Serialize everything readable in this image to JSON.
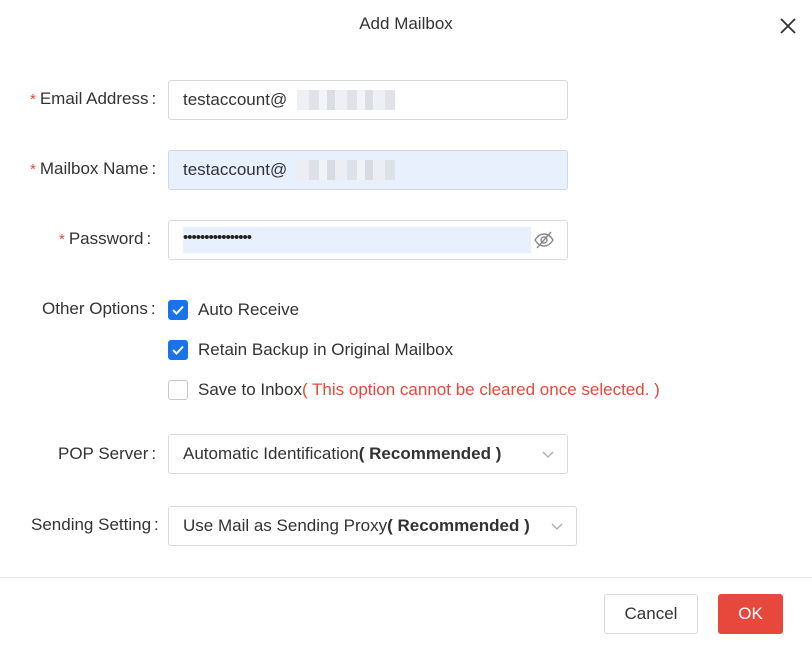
{
  "dialog": {
    "title": "Add Mailbox",
    "close_icon": "close-icon"
  },
  "form": {
    "email": {
      "label": "Email Address",
      "required": true,
      "value": "testaccount@"
    },
    "mailbox_name": {
      "label": "Mailbox Name",
      "required": true,
      "value": "testaccount@"
    },
    "password": {
      "label": "Password",
      "required": true,
      "value": "••••••••••••••••",
      "toggle_icon": "eye-slash-icon"
    },
    "other_options": {
      "label": "Other Options",
      "auto_receive": {
        "label": "Auto Receive",
        "checked": true
      },
      "retain_backup": {
        "label": "Retain Backup in Original Mailbox",
        "checked": true
      },
      "save_to_inbox": {
        "label": "Save to Inbox",
        "warning": "( This option cannot be cleared once selected. )",
        "checked": false
      }
    },
    "pop_server": {
      "label": "POP Server",
      "value": "Automatic Identification",
      "value_suffix": "( Recommended )"
    },
    "sending_setting": {
      "label": "Sending Setting",
      "value": "Use Mail as Sending Proxy",
      "value_suffix": "( Recommended )"
    },
    "required_mark": "*",
    "colon": ":"
  },
  "footer": {
    "cancel_label": "Cancel",
    "ok_label": "OK"
  },
  "colors": {
    "accent": "#1a73e8",
    "danger": "#e8473b",
    "autofill": "#e8f0fe"
  }
}
